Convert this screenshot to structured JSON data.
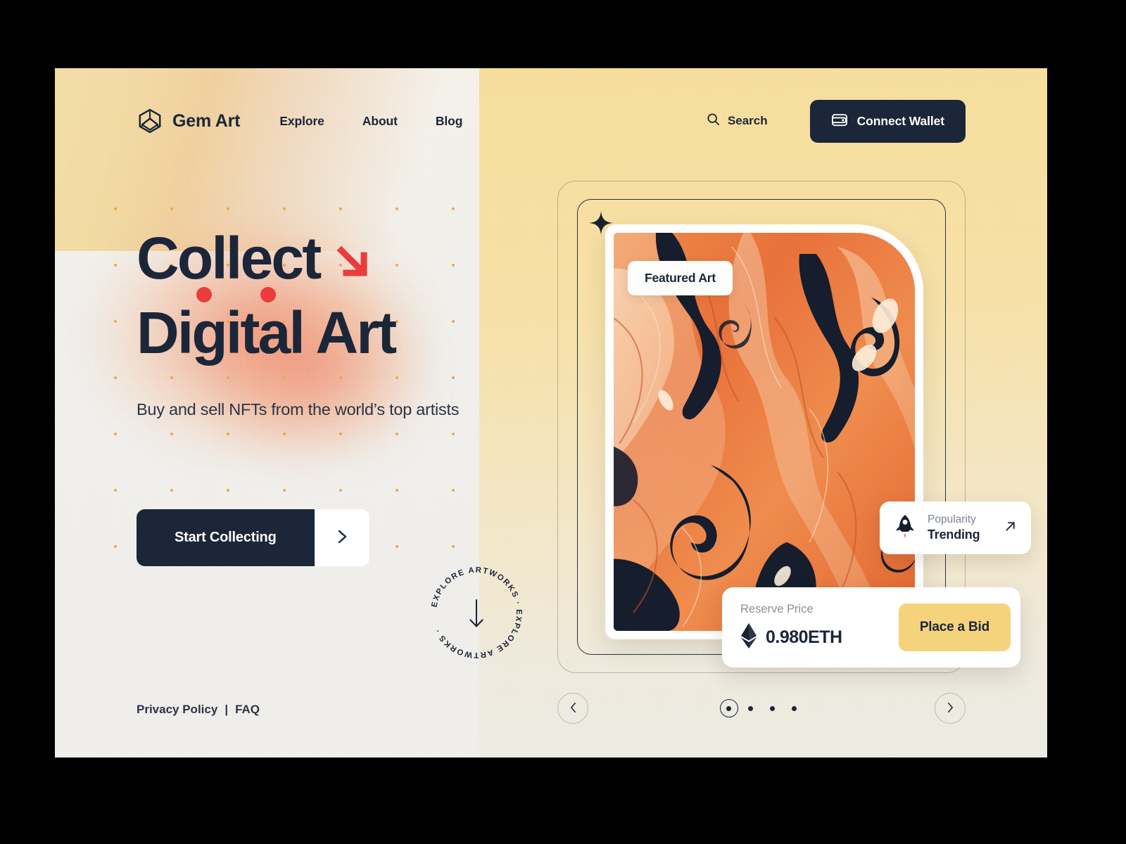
{
  "brand": {
    "name": "Gem Art",
    "logo_icon": "gem-hexagon-icon"
  },
  "nav": {
    "items": [
      {
        "label": "Explore"
      },
      {
        "label": "About"
      },
      {
        "label": "Blog"
      }
    ]
  },
  "header": {
    "search_label": "Search",
    "search_icon": "search-icon",
    "connect_label": "Connect Wallet",
    "wallet_icon": "wallet-icon"
  },
  "hero": {
    "headline_line1": "Collect",
    "headline_arrow_icon": "arrow-down-right-icon",
    "headline_line2": "Digital Art",
    "subtitle": "Buy and sell NFTs from the world’s top artists",
    "cta_label": "Start Collecting",
    "cta_arrow_icon": "chevron-right-icon"
  },
  "explore_badge": {
    "ring_text": "EXPLORE ARTWORKS · EXPLORE ARTWORKS · ",
    "center_icon": "arrow-down-icon"
  },
  "footer": {
    "privacy_label": "Privacy Policy",
    "separator": "|",
    "faq_label": "FAQ"
  },
  "showcase": {
    "featured_badge": "Featured Art",
    "sparkle_icon": "sparkle-icon",
    "artwork_alt": "abstract orange marbled fluid-pour artwork",
    "popularity": {
      "icon": "rocket-icon",
      "label": "Popularity",
      "value": "Trending",
      "trend_icon": "arrow-up-right-icon"
    },
    "bid": {
      "label": "Reserve Price",
      "currency_icon": "ethereum-icon",
      "price": "0.980ETH",
      "button_label": "Place a Bid"
    }
  },
  "carousel": {
    "prev_icon": "chevron-left-icon",
    "next_icon": "chevron-right-icon",
    "total_slides": 4,
    "active_slide": 1
  },
  "colors": {
    "ink": "#1b2639",
    "accent_red": "#ea3c3c",
    "accent_yellow": "#f5d37d",
    "accent_orange": "#f0a23c",
    "panel_left": "#f0efec",
    "panel_right": "#f6dd9a"
  }
}
